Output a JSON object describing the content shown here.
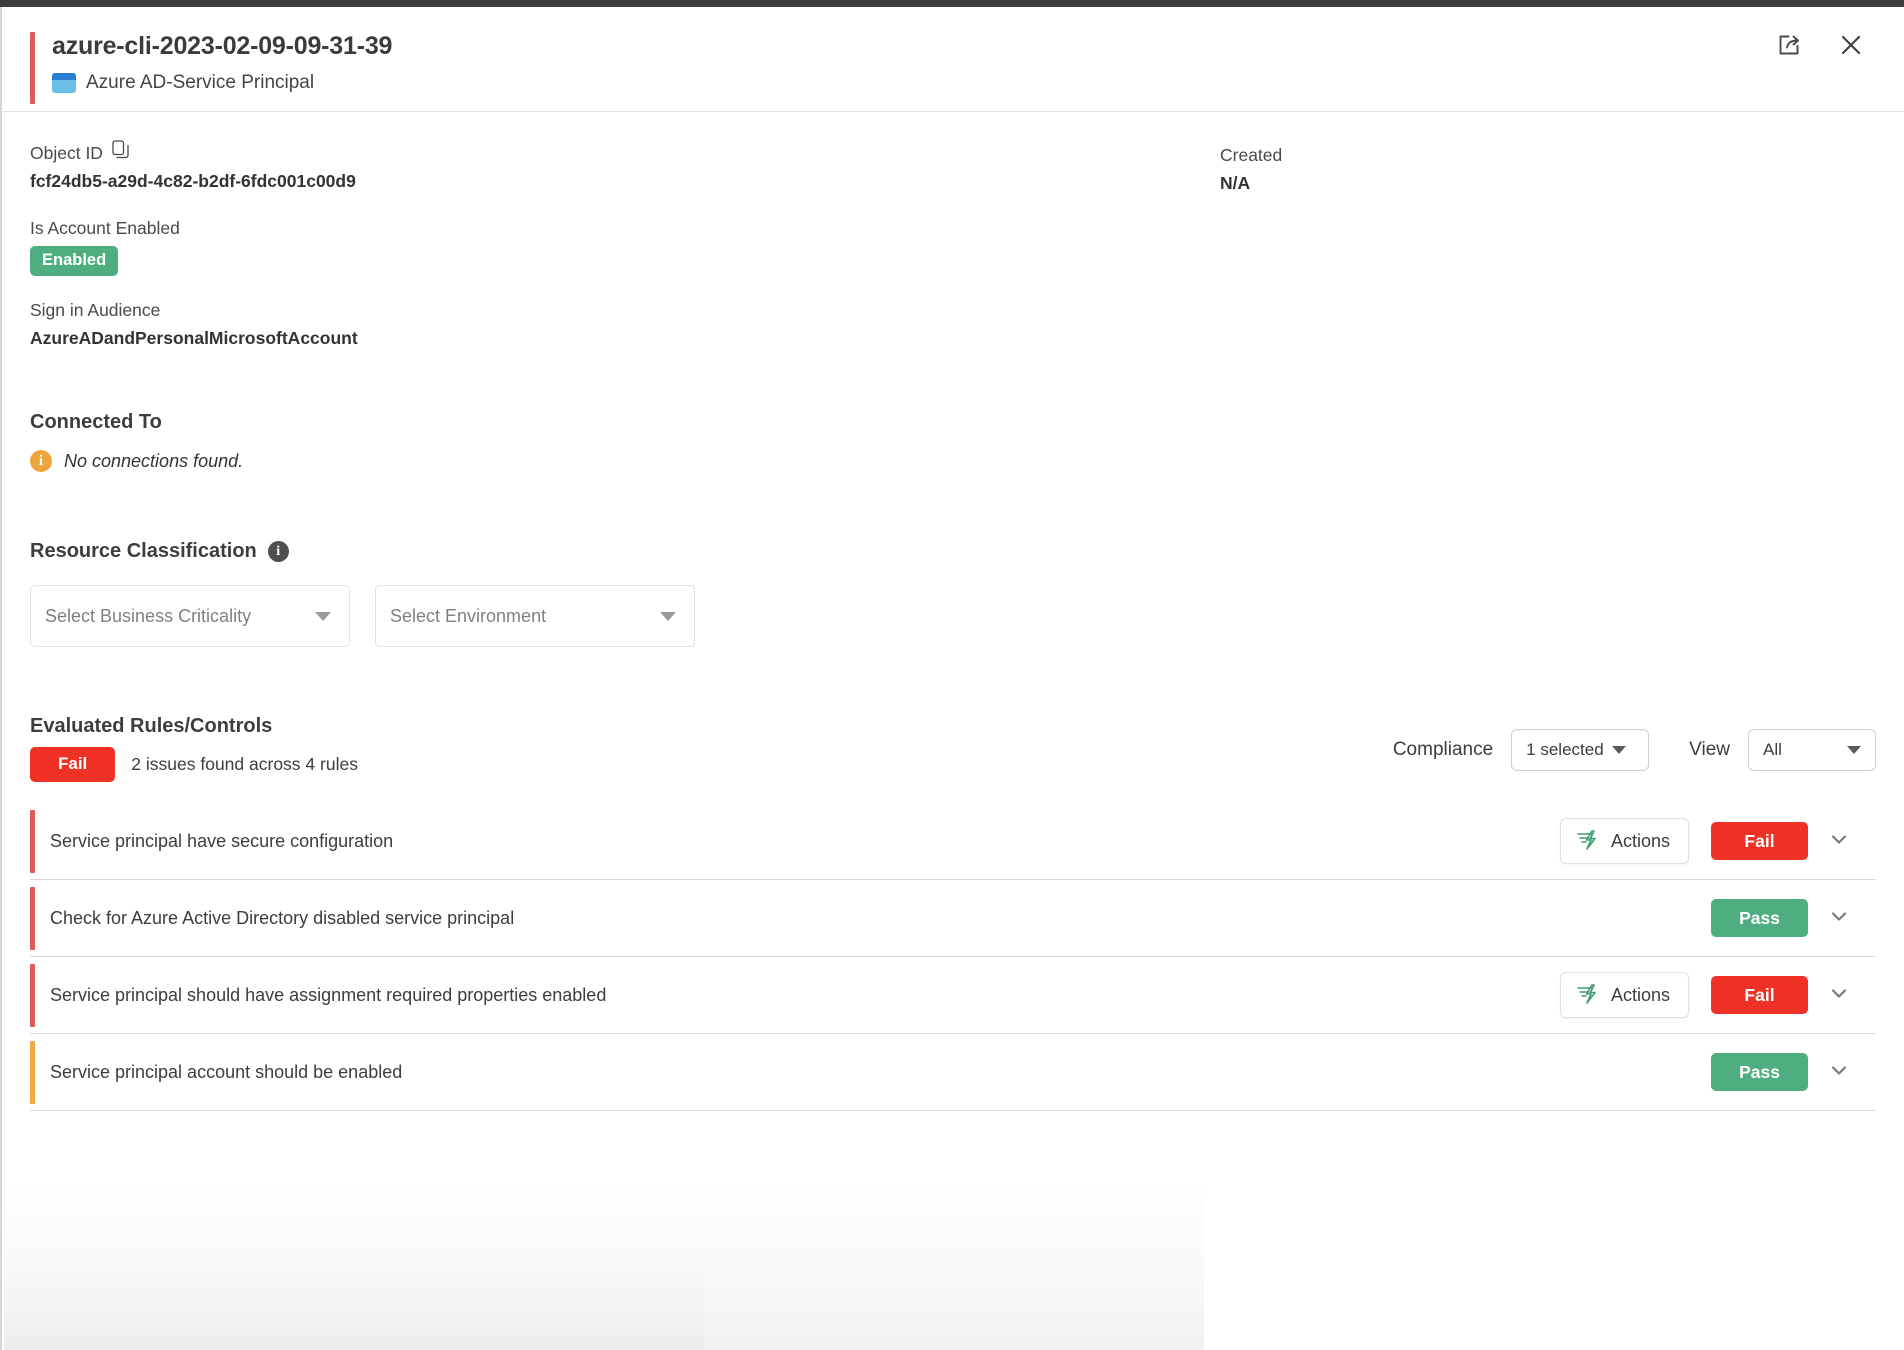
{
  "header": {
    "title": "azure-cli-2023-02-09-09-31-39",
    "resource_type": "Azure AD-Service Principal",
    "type_icon": "window-icon",
    "share_icon": "share-icon",
    "close_icon": "close-icon"
  },
  "properties": {
    "object_id": {
      "label": "Object ID",
      "value": "fcf24db5-a29d-4c82-b2df-6fdc001c00d9",
      "copy_icon": "copy-icon"
    },
    "is_account_enabled": {
      "label": "Is Account Enabled",
      "value": "Enabled"
    },
    "sign_in_audience": {
      "label": "Sign in Audience",
      "value": "AzureADandPersonalMicrosoftAccount"
    },
    "created": {
      "label": "Created",
      "value": "N/A"
    }
  },
  "connected_to": {
    "title": "Connected To",
    "empty_message": "No connections found.",
    "info_icon": "info-icon"
  },
  "resource_classification": {
    "title": "Resource Classification",
    "info_icon": "info-icon",
    "business_criticality_placeholder": "Select Business Criticality",
    "environment_placeholder": "Select Environment"
  },
  "evaluated_rules": {
    "title": "Evaluated Rules/Controls",
    "overall_status": "Fail",
    "summary": "2 issues found across 4 rules",
    "compliance_label": "Compliance",
    "compliance_value": "1 selected",
    "view_label": "View",
    "view_value": "All",
    "actions_label": "Actions",
    "actions_icon": "lightning-bolt-icon",
    "expand_icon": "chevron-down-icon",
    "rows": [
      {
        "name": "Service principal have secure configuration",
        "status": "Fail",
        "severity": "red",
        "has_actions": true
      },
      {
        "name": "Check for Azure Active Directory disabled service principal",
        "status": "Pass",
        "severity": "red",
        "has_actions": false
      },
      {
        "name": "Service principal should have assignment required properties enabled",
        "status": "Fail",
        "severity": "red",
        "has_actions": true
      },
      {
        "name": "Service principal account should be enabled",
        "status": "Pass",
        "severity": "amber",
        "has_actions": false
      }
    ]
  },
  "colors": {
    "fail_red": "#ee3124",
    "pass_green": "#4fae80",
    "accent_red": "#dd5b5b",
    "accent_amber": "#eeaa43",
    "info_amber": "#eda43a",
    "type_icon_blue": "#68c0e8"
  }
}
